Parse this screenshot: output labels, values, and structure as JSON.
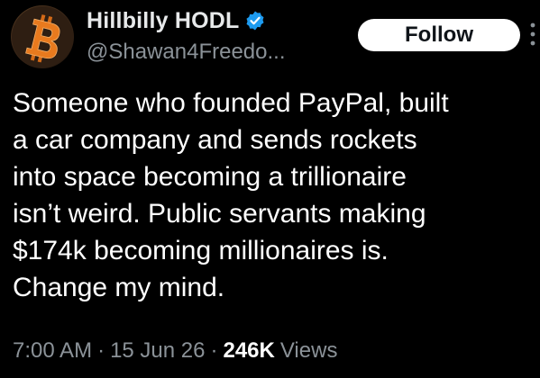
{
  "author": {
    "display_name": "Hillbilly HODL",
    "handle": "@Shawan4Freedo...",
    "verified": true,
    "avatar_icon": "bitcoin-logo-icon"
  },
  "actions": {
    "follow_label": "Follow",
    "more_icon": "more-options-icon"
  },
  "tweet": {
    "lines": [
      "Someone who founded PayPal, built",
      "a car company and sends rockets",
      "into space becoming a trillionaire",
      "isn’t weird. Public servants making",
      "$174k becoming millionaires is.",
      "Change my mind."
    ]
  },
  "meta": {
    "time": "7:00 AM",
    "separator": "·",
    "date": "15 Jun 26",
    "views_count": "246K",
    "views_label": "Views"
  },
  "colors": {
    "background": "#000000",
    "text": "#ffffff",
    "secondary": "#8b9298",
    "verified_badge": "#1d9bf0",
    "avatar_orange": "#e87a1e"
  }
}
